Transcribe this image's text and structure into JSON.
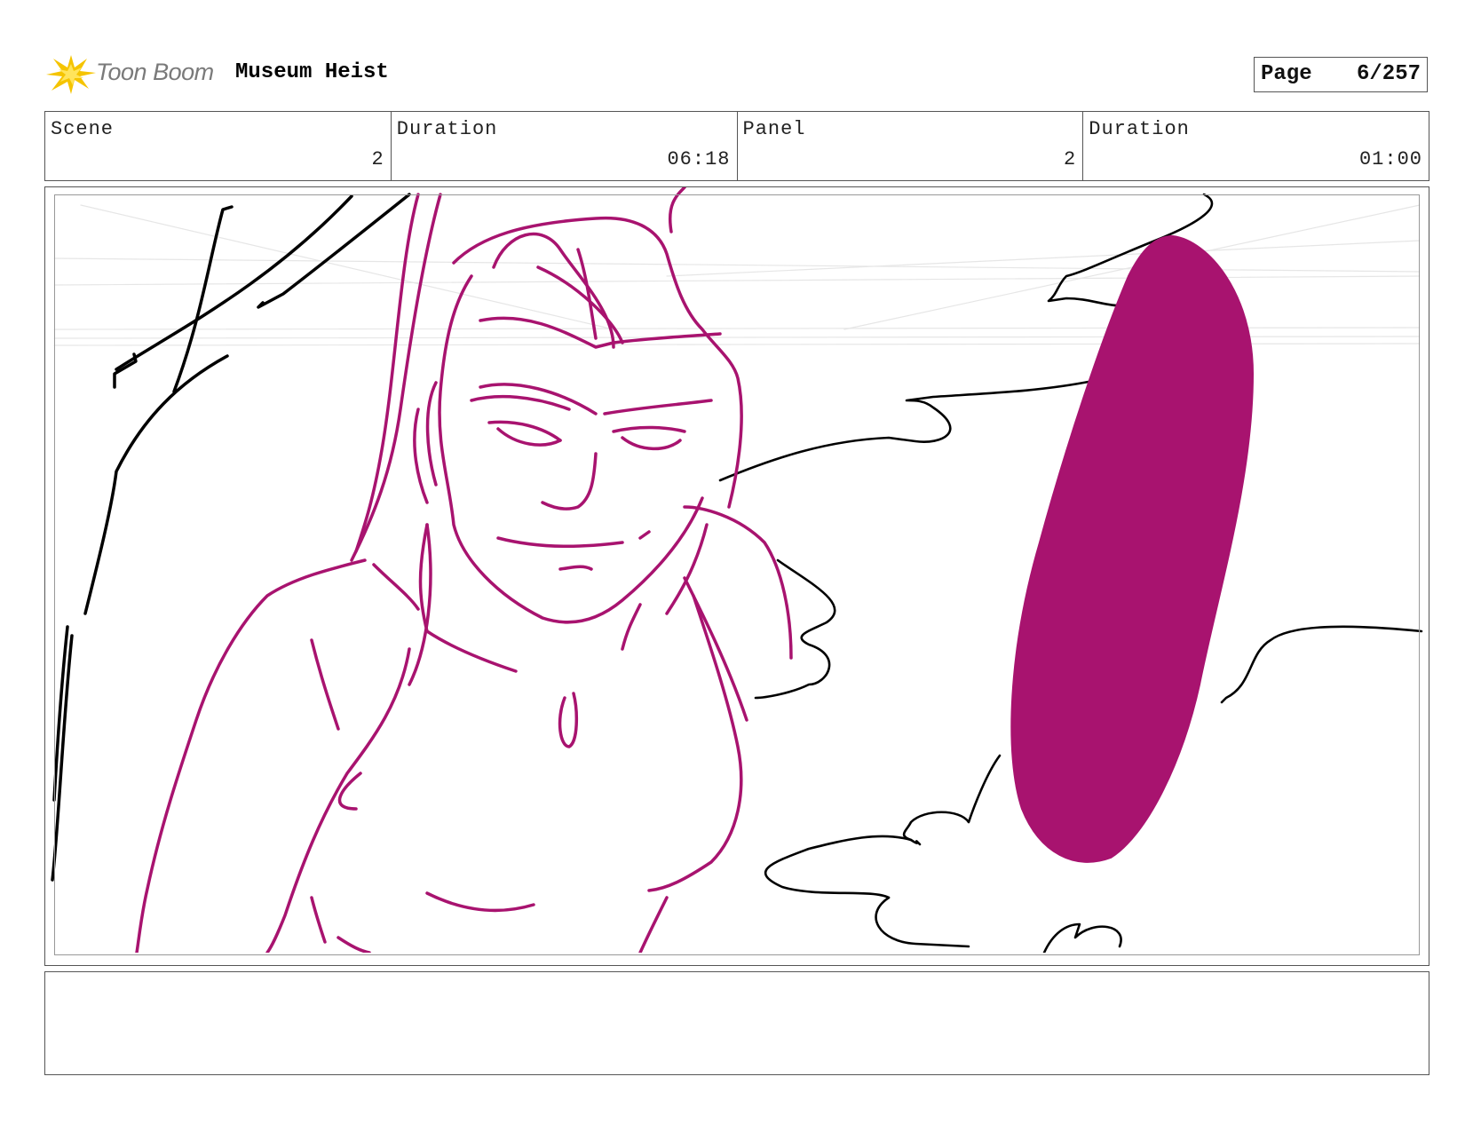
{
  "header": {
    "logo_text": "Toon Boom",
    "project_title": "Museum Heist"
  },
  "page": {
    "label": "Page",
    "value": "6/257"
  },
  "info": {
    "scene_label": "Scene",
    "scene_value": "2",
    "scene_duration_label": "Duration",
    "scene_duration_value": "06:18",
    "panel_label": "Panel",
    "panel_value": "2",
    "panel_duration_label": "Duration",
    "panel_duration_value": "01:00"
  },
  "colors": {
    "sketch_magenta": "#a8136f",
    "sketch_black": "#000000",
    "logo_yellow": "#f5c400"
  },
  "notes": {
    "text": ""
  }
}
